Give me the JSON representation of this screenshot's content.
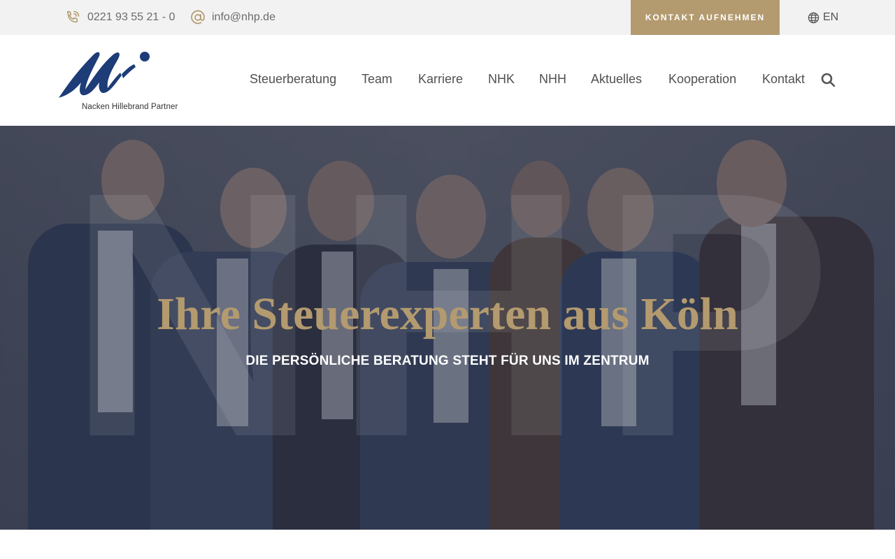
{
  "topbar": {
    "phone": "0221 93 55 21 - 0",
    "phone_icon": "phone-icon",
    "email": "info@nhp.de",
    "email_icon": "at-icon",
    "cta_label": "KONTAKT AUFNEHMEN",
    "language": "EN",
    "language_icon": "globe-icon"
  },
  "header": {
    "logo_text": "Nacken Hillebrand Partner",
    "nav": [
      "Steuerberatung",
      "Team",
      "Karriere",
      "NHK",
      "NHH",
      "Aktuelles",
      "Kooperation",
      "Kontakt"
    ],
    "search_icon": "search-icon"
  },
  "hero": {
    "watermark": "NHP",
    "title": "Ihre Steuerexperten aus Köln",
    "subtitle": "DIE PERSÖNLICHE BERATUNG STEHT FÜR UNS IM ZENTRUM"
  },
  "colors": {
    "accent": "#b39a6f",
    "topbar_bg": "#f2f2f2",
    "logo_blue": "#1d3c78",
    "hero_overlay": "#3c4253"
  }
}
